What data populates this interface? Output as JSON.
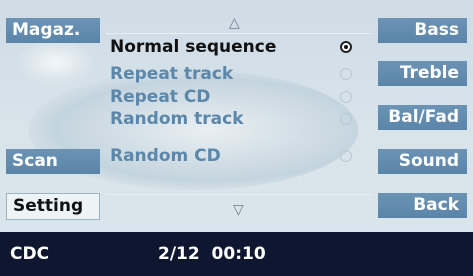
{
  "left_buttons": {
    "magazine_label": "Magaz.",
    "scan_label": "Scan",
    "setting_label": "Setting"
  },
  "right_buttons": {
    "bass_label": "Bass",
    "treble_label": "Treble",
    "balfad_label": "Bal/Fad",
    "sound_label": "Sound",
    "back_label": "Back"
  },
  "playback_menu": {
    "scroll_up_glyph": "△",
    "scroll_down_glyph": "▽",
    "items": [
      {
        "label": "Normal sequence",
        "selected": true
      },
      {
        "label": "Repeat track",
        "selected": false
      },
      {
        "label": "Repeat CD",
        "selected": false
      },
      {
        "label": "Random track",
        "selected": false
      },
      {
        "label": "Random CD",
        "selected": false
      }
    ]
  },
  "status_bar": {
    "source": "CDC",
    "track_time": "2/12  00:10"
  },
  "colors": {
    "button_blue": "#5f88ab",
    "selected_text": "#111111",
    "unselected_text": "#5b87ab",
    "status_bar_bg": "#0f1730"
  }
}
